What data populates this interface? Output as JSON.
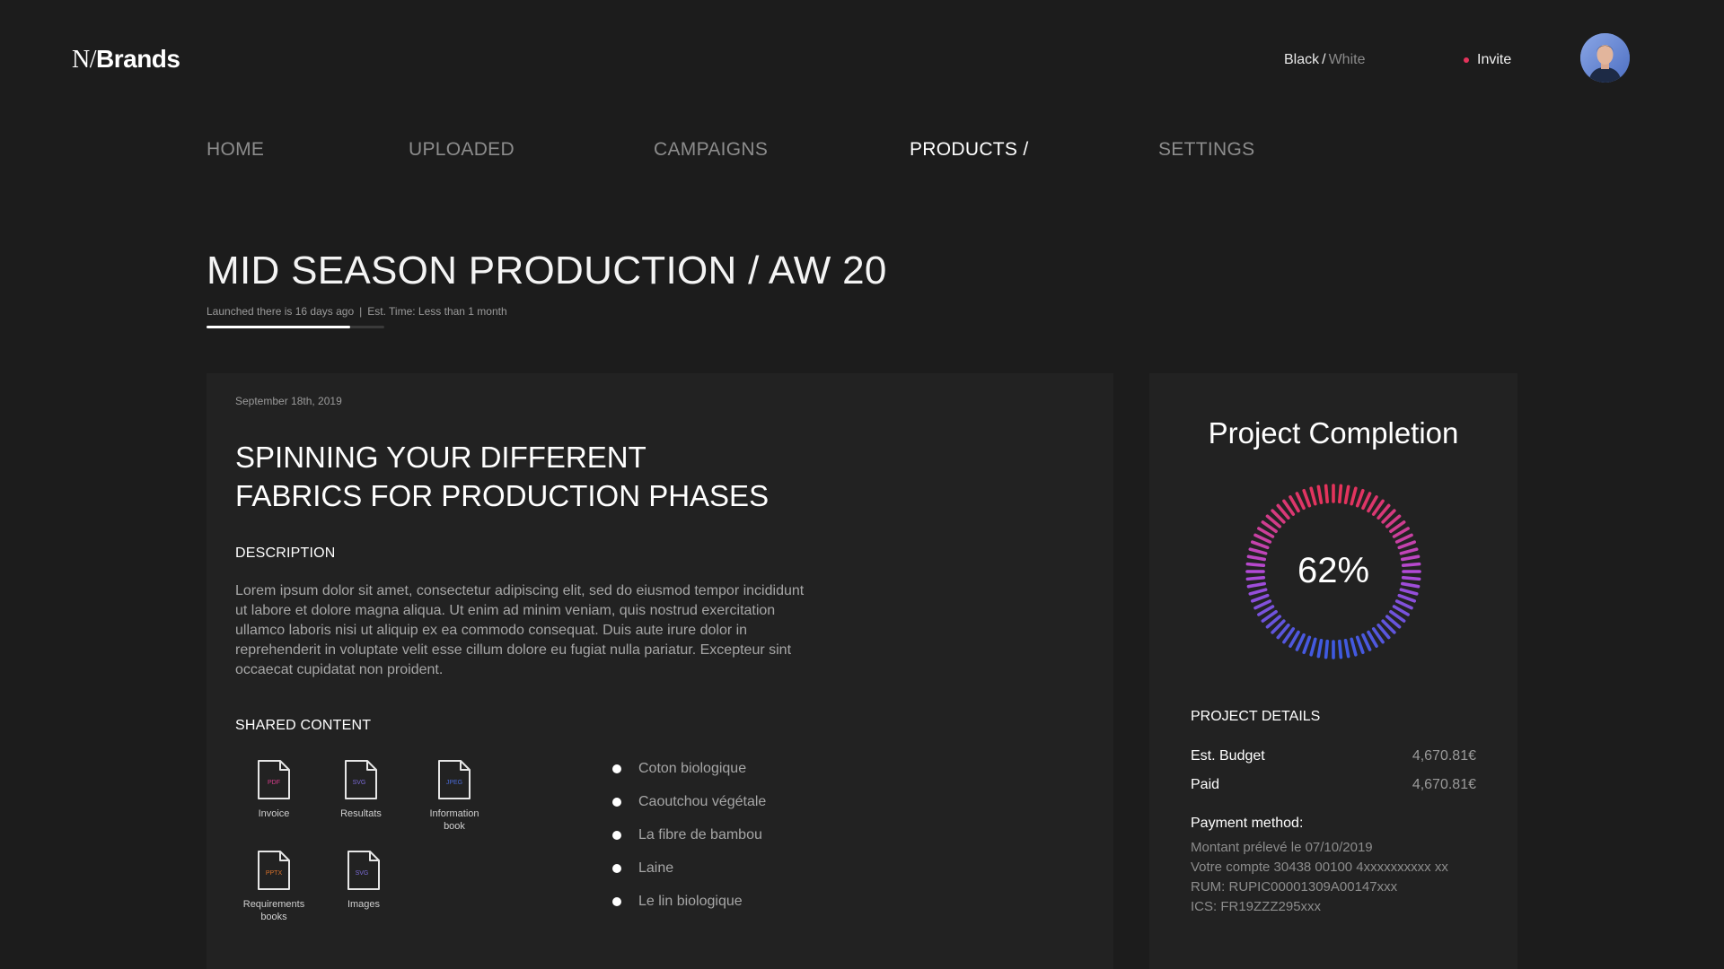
{
  "brand": {
    "logo_n": "N/",
    "logo_b": "Brands"
  },
  "header": {
    "theme_black": "Black",
    "theme_sep": "/",
    "theme_white": "White",
    "invite_label": "Invite",
    "invite_dot_color": "#e4335b"
  },
  "nav": {
    "items": [
      {
        "label": "HOME"
      },
      {
        "label": "UPLOADED"
      },
      {
        "label": "CAMPAIGNS"
      },
      {
        "label": "PRODUCTS /"
      },
      {
        "label": "SETTINGS"
      }
    ],
    "active_index": 3
  },
  "page": {
    "title": "MID SEASON PRODUCTION / AW 20",
    "launched": "Launched there is 16 days ago",
    "pipe": "|",
    "est_time": "Est. Time: Less than 1 month",
    "progress_fraction": 0.81
  },
  "card": {
    "date": "September 18th, 2019",
    "headline_line1": "SPINNING YOUR DIFFERENT",
    "headline_line2": "FABRICS FOR PRODUCTION PHASES",
    "description_label": "DESCRIPTION",
    "description": "Lorem ipsum dolor sit amet, consectetur adipiscing elit, sed do eiusmod tempor incididunt ut labore et dolore magna aliqua. Ut enim ad minim veniam, quis nostrud exercitation ullamco laboris nisi ut aliquip ex ea commodo consequat. Duis aute irure dolor in reprehenderit in voluptate velit esse cillum dolore eu fugiat nulla pariatur. Excepteur sint occaecat cupidatat non proident.",
    "shared_label": "SHARED CONTENT",
    "files": [
      {
        "ext": "PDF",
        "ext_color": "#d63d8a",
        "name_line1": "Invoice",
        "name_line2": ""
      },
      {
        "ext": "SVG",
        "ext_color": "#7a6ad6",
        "name_line1": "Resultats",
        "name_line2": ""
      },
      {
        "ext": "JPEG",
        "ext_color": "#4a6ad6",
        "name_line1": "Information",
        "name_line2": "book"
      },
      {
        "ext": "PPTX",
        "ext_color": "#d6702a",
        "name_line1": "Requirements",
        "name_line2": "books"
      },
      {
        "ext": "SVG",
        "ext_color": "#7a6ad6",
        "name_line1": "Images",
        "name_line2": ""
      }
    ],
    "materials": [
      "Coton biologique",
      "Caoutchou végétale",
      "La fibre de bambou",
      "Laine",
      "Le lin biologique"
    ]
  },
  "completion": {
    "title": "Project Completion",
    "percent_label": "62%",
    "value": 0.62,
    "gradient_start": "#e4335b",
    "gradient_mid": "#b34ad8",
    "gradient_end": "#3f5ae0"
  },
  "details": {
    "label": "PROJECT DETAILS",
    "budget_label": "Est. Budget",
    "budget_value": "4,670.81€",
    "paid_label": "Paid",
    "paid_value": "4,670.81€",
    "payment_label": "Payment method:",
    "payment_lines": [
      "Montant prélevé le 07/10/2019",
      "Votre compte 30438 00100 4xxxxxxxxxx xx",
      "RUM: RUPIC00001309A00147xxx",
      "ICS: FR19ZZZ295xxx"
    ]
  }
}
